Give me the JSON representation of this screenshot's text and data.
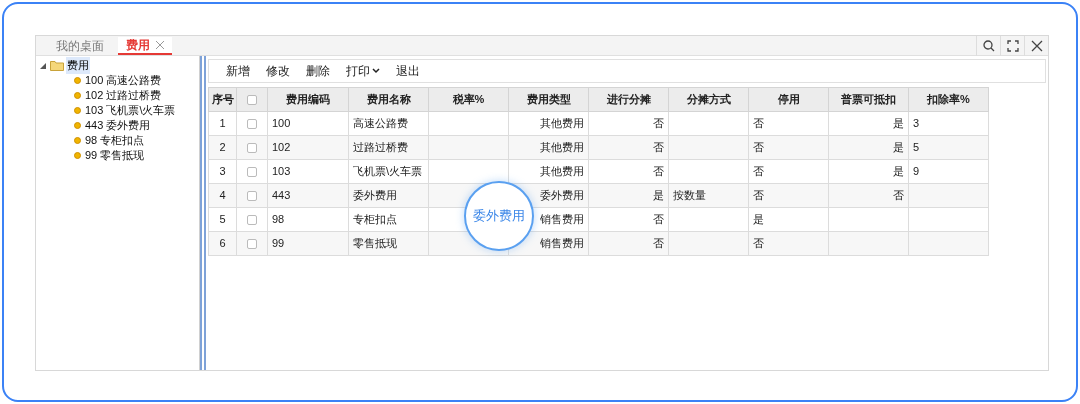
{
  "tabs": [
    {
      "label": "我的桌面",
      "selected": false,
      "closable": false
    },
    {
      "label": "费用",
      "selected": true,
      "closable": true
    }
  ],
  "tree": {
    "label": "费用",
    "expanded": true,
    "children": [
      {
        "label": "100 高速公路费"
      },
      {
        "label": "102 过路过桥费"
      },
      {
        "label": "103 飞机票\\火车票"
      },
      {
        "label": "443 委外费用"
      },
      {
        "label": "98 专柜扣点"
      },
      {
        "label": "99 零售抵现"
      }
    ]
  },
  "toolbar": [
    {
      "label": "新增",
      "dropdown": false
    },
    {
      "label": "修改",
      "dropdown": false
    },
    {
      "label": "删除",
      "dropdown": false
    },
    {
      "label": "打印",
      "dropdown": true
    },
    {
      "label": "退出",
      "dropdown": false
    }
  ],
  "table": {
    "columns": [
      "序号",
      "",
      "费用编码",
      "费用名称",
      "税率%",
      "费用类型",
      "进行分摊",
      "分摊方式",
      "停用",
      "普票可抵扣",
      "扣除率%"
    ],
    "header_checked": false,
    "rows": [
      {
        "checked": false,
        "cells": [
          "1",
          "",
          "100",
          "高速公路费",
          "",
          "其他费用",
          "否",
          "",
          "否",
          "是",
          "3"
        ]
      },
      {
        "checked": false,
        "cells": [
          "2",
          "",
          "102",
          "过路过桥费",
          "",
          "其他费用",
          "否",
          "",
          "否",
          "是",
          "5"
        ]
      },
      {
        "checked": false,
        "cells": [
          "3",
          "",
          "103",
          "飞机票\\火车票",
          "",
          "其他费用",
          "否",
          "",
          "否",
          "是",
          "9"
        ]
      },
      {
        "checked": false,
        "cells": [
          "4",
          "",
          "443",
          "委外费用",
          "",
          "委外费用",
          "是",
          "按数量",
          "否",
          "否",
          ""
        ]
      },
      {
        "checked": false,
        "cells": [
          "5",
          "",
          "98",
          "专柜扣点",
          "",
          "销售费用",
          "否",
          "",
          "是",
          "",
          ""
        ]
      },
      {
        "checked": false,
        "cells": [
          "6",
          "",
          "99",
          "零售抵现",
          "",
          "销售费用",
          "否",
          "",
          "否",
          "",
          ""
        ]
      }
    ]
  },
  "magnifier": {
    "text": "委外费用"
  }
}
